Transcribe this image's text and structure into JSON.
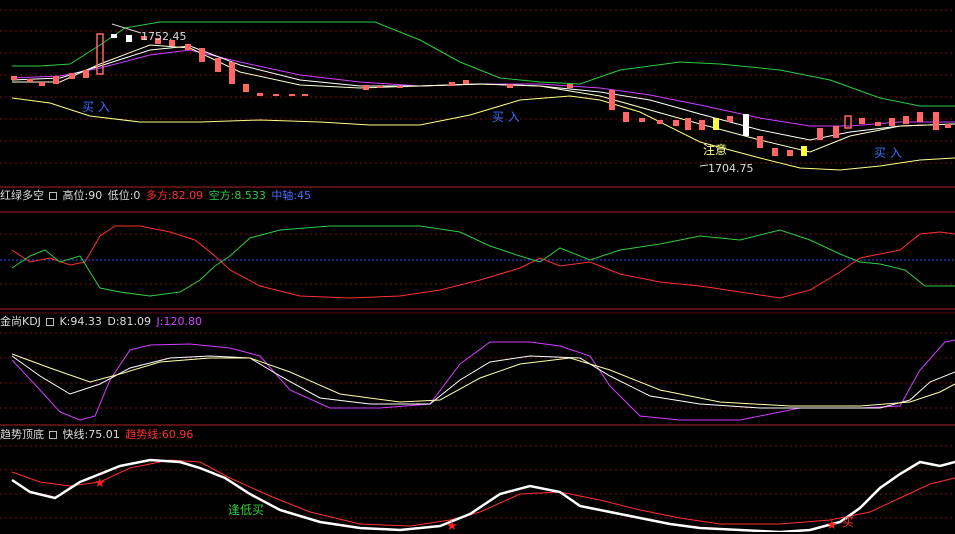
{
  "colors": {
    "background": "#000000",
    "grid": "#7a1010",
    "separator": "#b02020",
    "white": "#ffffff",
    "yellow": "#ffff66",
    "green": "#2ecc40",
    "red": "#ff3030",
    "blue": "#4a6cff",
    "magenta": "#d040ff",
    "up_candle": "#ff6666",
    "down_candle": "#ff6666"
  },
  "panel_main": {
    "high_label": "1752.45",
    "low_label": "1704.75",
    "buy_labels": [
      "买  入",
      "买  入",
      "买  入"
    ],
    "warn_label": "注意"
  },
  "panel_ind1": {
    "name": "红绿多空",
    "fields": [
      {
        "label": "高位:90",
        "color": "#dddddd"
      },
      {
        "label": "低位:0",
        "color": "#dddddd"
      },
      {
        "label": "多方:82.09",
        "color": "#ff3030"
      },
      {
        "label": "空方:8.533",
        "color": "#2ecc40"
      },
      {
        "label": "中轴:45",
        "color": "#4a6cff"
      }
    ]
  },
  "panel_ind2": {
    "name": "金尚KDJ",
    "fields": [
      {
        "label": "K:94.33",
        "color": "#dddddd"
      },
      {
        "label": "D:81.09",
        "color": "#dddddd"
      },
      {
        "label": "J:120.80",
        "color": "#d040ff"
      }
    ]
  },
  "panel_ind3": {
    "name": "趋势顶底",
    "fields": [
      {
        "label": "快线:75.01",
        "color": "#dddddd"
      },
      {
        "label": "趋势线:60.96",
        "color": "#ff3030"
      }
    ],
    "signal_low": "逢低买",
    "signal_buy": "买"
  },
  "chart_data": {
    "type": "line",
    "title": "",
    "main_price": {
      "high": 1752.45,
      "low": 1704.75
    },
    "indicator_red_green": {
      "high": 90,
      "low": 0,
      "bull": 82.09,
      "bear": 8.533,
      "axis": 45
    },
    "indicator_kdj": {
      "K": 94.33,
      "D": 81.09,
      "J": 120.8
    },
    "indicator_trend": {
      "fast": 75.01,
      "trend": 60.96
    }
  }
}
